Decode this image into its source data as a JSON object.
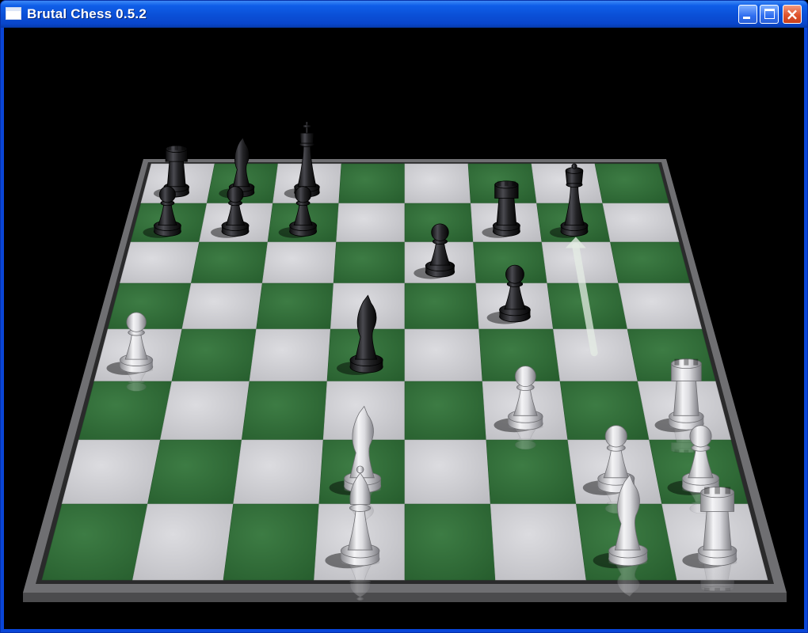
{
  "window": {
    "title": "Brutal Chess 0.5.2",
    "controls": [
      "minimize-icon",
      "maximize-icon",
      "close-icon"
    ]
  },
  "board": {
    "files": 8,
    "ranks": 8,
    "light_square_color": "#c8c8cc",
    "dark_square_color": "#2f6a36",
    "frame_color": "#8a8a8a",
    "background_color": "#000000",
    "black_pieces": [
      {
        "id": "black-rook-a8",
        "type": "rook",
        "file": 0,
        "rank": 7
      },
      {
        "id": "black-knight-b8",
        "type": "knight",
        "file": 1,
        "rank": 7
      },
      {
        "id": "black-king-c8",
        "type": "king",
        "file": 2,
        "rank": 7
      },
      {
        "id": "black-rook-e7",
        "type": "rook",
        "file": 5,
        "rank": 6
      },
      {
        "id": "black-queen-f7",
        "type": "queen",
        "file": 6,
        "rank": 6
      },
      {
        "id": "black-pawn-a7",
        "type": "pawn",
        "file": 0,
        "rank": 6
      },
      {
        "id": "black-pawn-b7",
        "type": "pawn",
        "file": 1,
        "rank": 6
      },
      {
        "id": "black-pawn-c7",
        "type": "pawn",
        "file": 2,
        "rank": 6
      },
      {
        "id": "black-pawn-e6",
        "type": "pawn",
        "file": 4,
        "rank": 5
      },
      {
        "id": "black-pawn-f5",
        "type": "pawn",
        "file": 5,
        "rank": 4
      },
      {
        "id": "black-knight-d4",
        "type": "knight",
        "file": 3,
        "rank": 3
      }
    ],
    "white_pieces": [
      {
        "id": "white-pawn-a4",
        "type": "pawn",
        "file": 0,
        "rank": 3
      },
      {
        "id": "white-pawn-f3",
        "type": "pawn",
        "file": 5,
        "rank": 2
      },
      {
        "id": "white-rook-h3",
        "type": "rook",
        "file": 7,
        "rank": 2
      },
      {
        "id": "white-knight-d2",
        "type": "knight",
        "file": 3,
        "rank": 1
      },
      {
        "id": "white-pawn-g2",
        "type": "pawn",
        "file": 6,
        "rank": 1
      },
      {
        "id": "white-pawn-h2",
        "type": "pawn",
        "file": 7,
        "rank": 1
      },
      {
        "id": "white-bishop-d1",
        "type": "bishop",
        "file": 3,
        "rank": 0
      },
      {
        "id": "white-knight-g1",
        "type": "knight",
        "file": 6,
        "rank": 0
      },
      {
        "id": "white-rook-h1",
        "type": "rook",
        "file": 7,
        "rank": 0
      }
    ],
    "last_move_arrow": {
      "from_file": 6,
      "from_rank": 3,
      "to_file": 6,
      "to_rank": 6
    }
  }
}
